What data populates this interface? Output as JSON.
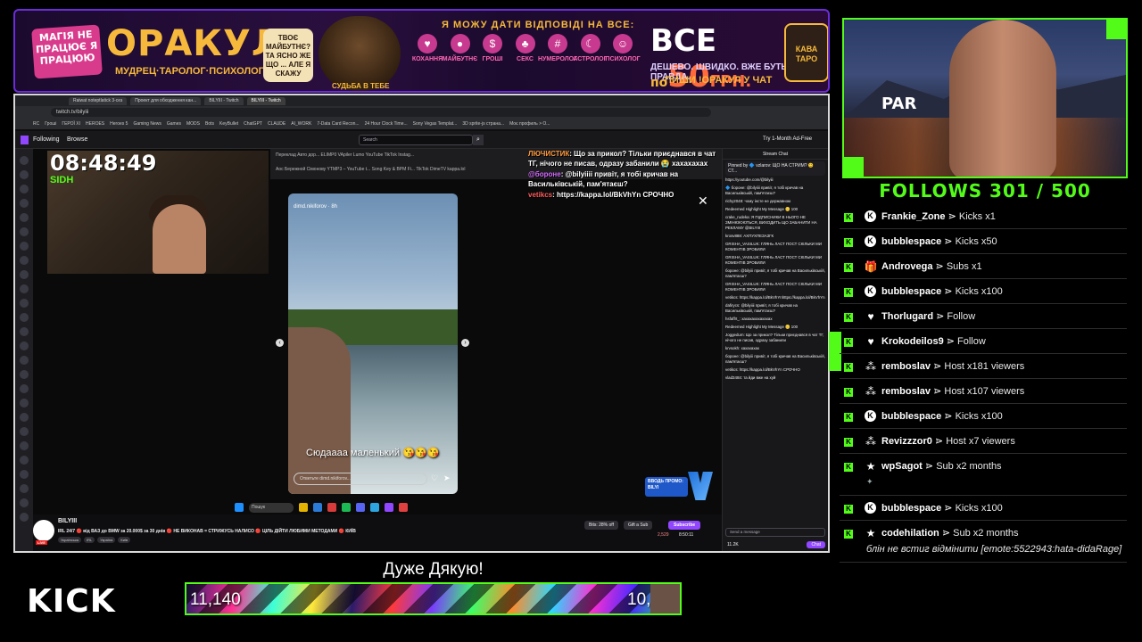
{
  "banner": {
    "badge": "МАГІЯ НЕ ПРАЦЮЄ Я ПРАЦЮЮ",
    "title": "ОРАКУЛ",
    "subtitle": "МУДРЕЦ·ТАРОЛОГ·ПСИХОЛОГ",
    "bubble": "ТВОЄ МАЙБУТНЄ? ТА ЯСНО ЖЕ ЩО ... АЛЕ Я СКАЖУ",
    "wizard_tag": "СУДЬБА В ТЕБЕ",
    "answer_line": "Я МОЖУ ДАТИ ВІДПОВІДІ НА ВСЕ:",
    "categories": [
      "КОХАННЯ",
      "МАЙБУТНЄ",
      "ГРОШІ",
      "СЕКС",
      "НУМЕРОЛОГ",
      "АСТРОЛОГ",
      "ПСИХОЛОГ"
    ],
    "price_big": "ВСЕ",
    "price_po": "по",
    "price_num": "50",
    "price_cur": "ГРН.",
    "line1": "ДЕШЕВО. ШВИДКО. ВЖЕ БУТЬ ПРАВДА.",
    "line2": "ПИШИ !ОРАКУЛ У ЧАТ",
    "cup": "КАВА ТАРО"
  },
  "browser": {
    "tabs": [
      "Raiwat noteptlatick 3-сез",
      "Проект для обходження кан...",
      "BILYIII - Twitch",
      "BILYIII - Twitch"
    ],
    "url": "twitch.tv/bilyiii",
    "bookmarks": [
      "RC",
      "Гроші",
      "ГЕРОЇ XI",
      "HEROES",
      "Heroes 5",
      "Gaming News",
      "Games",
      "MODS",
      "Bots",
      "KeyBullet",
      "ChatGPT",
      "CLAUDE",
      "AI_WORK",
      "7-Data Card Recon...",
      "24 Hour Clock Time...",
      "Sony Vegas Templat...",
      "3D sprite-js страна...",
      "Моє профиль > O..."
    ]
  },
  "twitch": {
    "following": "Following",
    "browse": "Browse",
    "search_placeholder": "Search",
    "ad_free": "Try 1-Month Ad-Free"
  },
  "player": {
    "clock": "08:48:49",
    "side_label": "SIDН",
    "inner_bookmarks_1": "Переклад  Авто дор...  ELIMP0  VApiler  Lumo  YouTube  TikTok  Instag...",
    "inner_bookmarks_2": "Аос  Бережной Сімонову  YTMP3 – YouTube t...  Song Key & BPM Fi...  TikTok  DimeTV  kappa.lol",
    "overchat": [
      {
        "name": "ЛЮЧИСТИК",
        "text": ": Що за прикол? Тільки приєднався в чат ТГ, нічого не писав, одразу забанили 😭 хахахахах"
      },
      {
        "name": "@бороне",
        "text": ": @bilyiiii привіт, я тобі кричав на Васильківській, пам'ятаєш?"
      },
      {
        "name": "vetikcs",
        "text": ": https://kappa.lol/BkVhYn СРОЧНО"
      }
    ],
    "story_user": "dimd.nikiforov · 8h",
    "story_caption": "Сюдаааа маленький 😘😘😘",
    "story_reply": "Ответьте dimd.nikiforov...",
    "taskbar_search": "Пошук",
    "promo": "ВВОДЬ ПРОМО: BILYI"
  },
  "info": {
    "name": "BILYIII",
    "live": "LIVE",
    "desc": "IRL 24/7 🔴 від ВАЗ до BMW за 20.000$ за 30 днів 🔴 НЕ ВИКОНАВ = СТРИЖУСЬ НАЛИСО 🔴 ЦІЛЬ ДІЙТИ ЛЮБИМИ МЕТОДАМИ 🔴 КИЇВ",
    "tags": [
      "Українська",
      "IRL",
      "Україна",
      "Київ"
    ],
    "bits": "Bits: 28% off",
    "gift": "Gift a Sub",
    "subscribe": "Subscribe",
    "viewers": "2,529",
    "uptime": "8:50:11"
  },
  "twchat": {
    "header": "Stream Chat",
    "pinned": "Pinned by 🔷 vzlarov: ЩО НА СТРИМ? 😊 СТ...",
    "messages": [
      "https://youtube.com/@bilyiii",
      "🔷 бороне: @bilyiiii привіт, я тобі кричав на Васильківській, пам'ятаєш?",
      "richy2048: чому інсте не державною",
      "Redeemed Highlight My Message 🪙 100",
      "crake_rudeka: Я ПІДПИСНИКИ В НЬОГО НЕ ЗМІНЮЮЮТЬСЯ, ВИХОДИТЬ ЩО ЗАБАНИТИ НА РЕКЛАМУ @BILYIII",
      "krosv888: АХПУХПЕЗАЗГК",
      "GRISHA_VASILUK: ГЛЯНЬ ЛАСТ ПОСТ СКІЛЬКИ МИ КОМЕНТІВ ЗРОБИЛИ",
      "GRISHA_VASILUK: ГЛЯНЬ ЛАСТ ПОСТ СКІЛЬКИ МИ КОМЕНТІВ ЗРОБИЛИ",
      "бороне: @bilyiii привіт, я тобі кричав на Васильківській, пам'ятаєш?",
      "GRISHA_VASILUK: ГЛЯНЬ ЛАСТ ПОСТ СКІЛЬКИ МИ КОМЕНТІВ ЗРОБИЛИ",
      "vetikcs: https://kappa.lol/BkVhYnhttps://kappa.lol/BkVhYn",
      "dafirycs: @bilyiiii привіт, я тобі кричав на Васильківській, пам'ятаєш?",
      "hsfaffrt_: хахахахахахахах",
      "Redeemed Highlight My Message 🪙 100",
      "Joggedum: Що за прикол? Тільки приєднався в чат ТГ, нічого не писав, одразу забанили",
      "krvsokh: хахахахах",
      "бороне: @bilyiii привіт, я тобі кричав на Васильківській, пам'ятаєш?",
      "vetikcs: https://kappa.lol/BkVhYn СРОЧНО",
      "vlad3484: та йди вже на хуй"
    ],
    "send_placeholder": "Send a message",
    "points": "11.2K",
    "chat_btn": "Chat"
  },
  "webcam": {
    "sign": "PAR"
  },
  "follows": "FOLLOWS 301 / 500",
  "events": [
    {
      "icon": "kick-coin-icon",
      "name": "Frankie_Zone",
      "action": "Kicks x1"
    },
    {
      "icon": "kick-coin-icon",
      "name": "bubblespace",
      "action": "Kicks x50"
    },
    {
      "icon": "gift-icon",
      "name": "Androvega",
      "action": "Subs x1"
    },
    {
      "icon": "kick-coin-icon",
      "name": "bubblespace",
      "action": "Kicks x100"
    },
    {
      "icon": "heart-icon",
      "name": "Thorlugard",
      "action": "Follow"
    },
    {
      "icon": "heart-icon",
      "name": "Krokodeilos9",
      "action": "Follow"
    },
    {
      "icon": "host-icon",
      "name": "remboslav",
      "action": "Host x181 viewers"
    },
    {
      "icon": "host-icon",
      "name": "remboslav",
      "action": "Host x107 viewers"
    },
    {
      "icon": "kick-coin-icon",
      "name": "bubblespace",
      "action": "Kicks x100"
    },
    {
      "icon": "host-icon",
      "name": "Revizzzor0",
      "action": "Host x7 viewers"
    },
    {
      "icon": "star-icon",
      "name": "wpSagot",
      "action": "Sub x2 months"
    },
    {
      "icon": "kick-coin-icon",
      "name": "bubblespace",
      "action": "Kicks x100"
    },
    {
      "icon": "star-icon",
      "name": "codehilation",
      "action": "Sub x2 months",
      "message": "блін не встиг відмінити [emote:5522943:hata-didaRage]"
    }
  ],
  "bottom": {
    "logo": "KICK",
    "thanks": "Дуже Дякую!",
    "goal_current": "11,140",
    "goal_target": "10,",
    "goal_fraction": 1.0
  }
}
